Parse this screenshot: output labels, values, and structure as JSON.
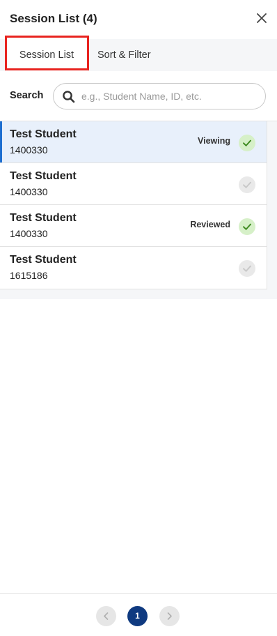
{
  "header": {
    "title": "Session List (4)",
    "close_icon": "close-icon"
  },
  "tabs": [
    {
      "label": "Session List",
      "active": true
    },
    {
      "label": "Sort & Filter",
      "active": false
    }
  ],
  "search": {
    "label": "Search",
    "placeholder": "e.g., Student Name, ID, etc.",
    "value": "",
    "icon": "search-icon"
  },
  "sessions": [
    {
      "name": "Test Student",
      "id": "1400330",
      "status": "Viewing",
      "checked": true,
      "selected": true
    },
    {
      "name": "Test Student",
      "id": "1400330",
      "status": "",
      "checked": false,
      "selected": false
    },
    {
      "name": "Test Student",
      "id": "1400330",
      "status": "Reviewed",
      "checked": true,
      "selected": false
    },
    {
      "name": "Test Student",
      "id": "1615186",
      "status": "",
      "checked": false,
      "selected": false
    }
  ],
  "pagination": {
    "current": "1",
    "prev_icon": "chevron-left-icon",
    "next_icon": "chevron-right-icon"
  },
  "colors": {
    "accent": "#1e6fd0",
    "selected_row": "#e8f0fb",
    "check_on": "#d6f0c8",
    "check_on_mark": "#3d8a1f",
    "check_off": "#e9e9e9",
    "page_active": "#0f3a80",
    "highlight_outline": "#e8231f"
  }
}
